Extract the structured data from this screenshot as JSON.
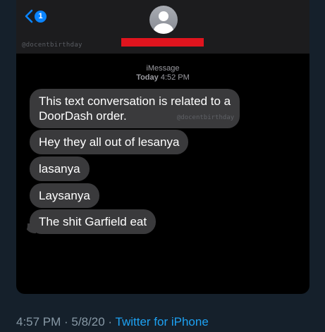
{
  "header": {
    "back_badge_count": "1",
    "watermark": "@docentbirthday"
  },
  "conversation": {
    "service": "iMessage",
    "day": "Today",
    "time": "4:52 PM",
    "messages": [
      {
        "line1": "This text conversation is related to a",
        "line2": "DoorDash order."
      },
      {
        "text": "Hey they all out of lesanya"
      },
      {
        "text": "lasanya"
      },
      {
        "text": "Laysanya"
      },
      {
        "text": "The shit Garfield eat"
      }
    ],
    "bubble_watermark": "@docentbirthday"
  },
  "tweet_footer": {
    "time": "4:57 PM",
    "separator1": " · ",
    "date": "5/8/20",
    "separator2": " · ",
    "source": "Twitter for iPhone"
  },
  "colors": {
    "accent": "#0a84ff",
    "bubble": "#3a3a3c",
    "redaction": "#e0141e",
    "twitter_link": "#1da1f2"
  }
}
